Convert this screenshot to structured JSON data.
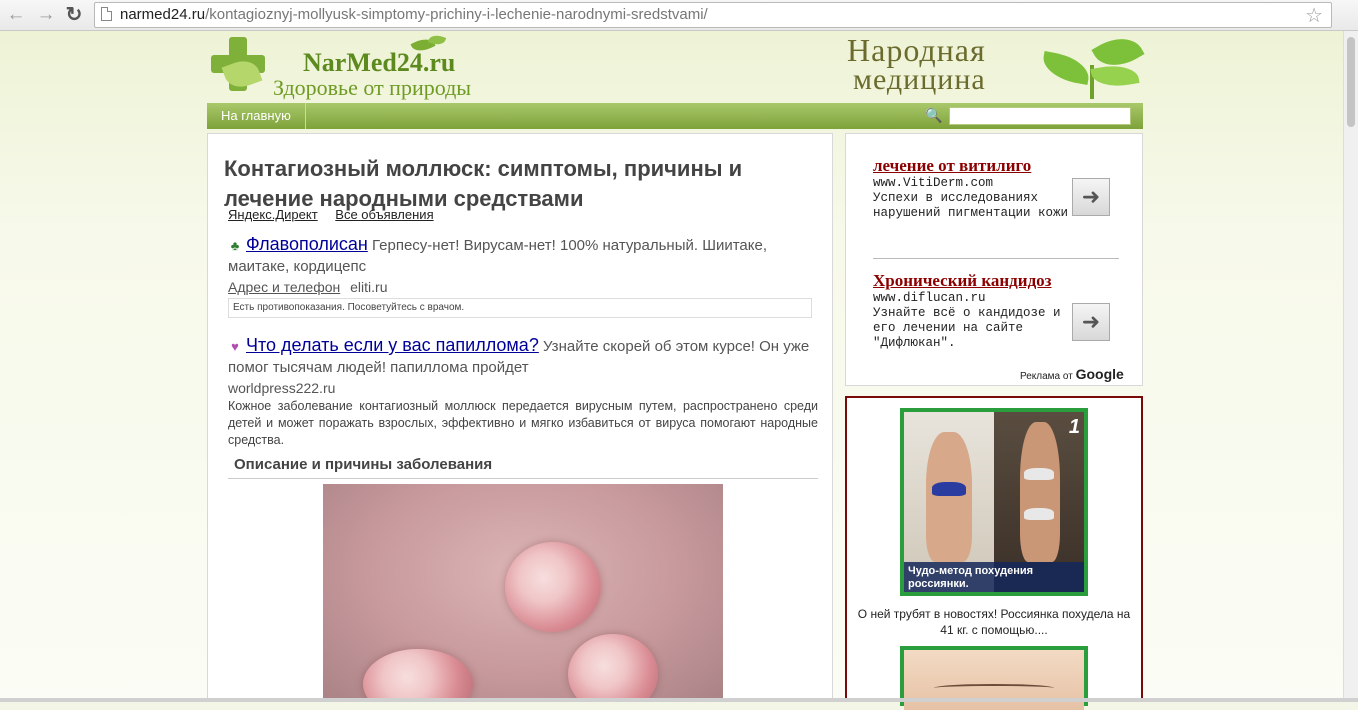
{
  "browser": {
    "url_domain": "narmed24.ru",
    "url_path": "/kontagioznyj-mollyusk-simptomy-prichiny-i-lechenie-narodnymi-sredstvami/"
  },
  "header": {
    "site_name": "NarMed24.ru",
    "tagline": "Здоровье от природы",
    "brand_line1": "Народная",
    "brand_line2": "медицина"
  },
  "nav": {
    "home": "На главную"
  },
  "article": {
    "title": "Контагиозный моллюск: симптомы, причины и лечение народными средствами",
    "ad_links": [
      "Яндекс.Директ",
      "Все объявления"
    ],
    "ads": [
      {
        "marker": "♣",
        "marker_color": "#2e7d32",
        "link": "Флавополисан",
        "text": "Герпесу-нет! Вирусам-нет! 100% натуральный. Шиитаке, маитаке, кордицепс",
        "sub_link": "Адрес и телефон",
        "domain": "eliti.ru",
        "disclaimer": "Есть противопоказания. Посоветуйтесь с врачом."
      },
      {
        "marker": "♥",
        "marker_color": "#b04fb0",
        "link": "Что делать если у вас папиллома?",
        "text": "Узнайте скорей об этом курсе! Он уже помог тысячам людей! папиллома пройдет",
        "domain": "worldpress222.ru"
      }
    ],
    "intro": "Кожное заболевание контагиозный моллюск передается вирусным путем, распространено среди детей и может поражать взрослых, эффективно и мягко избавиться от вируса помогают народные средства.",
    "section_title": "Описание и причины заболевания"
  },
  "sidebar": {
    "ads": [
      {
        "title": "лечение от витилиго",
        "url": "www.VitiDerm.com",
        "desc": "Успехи в исследованиях нарушений пигментации кожи"
      },
      {
        "title": "Хронический кандидоз",
        "url": "www.diflucan.ru",
        "desc": "Узнайте всё о кандидозе и его лечении на сайте \"Дифлюкан\"."
      }
    ],
    "google_label": "Реклама от",
    "google_brand": "Google",
    "promo_caption": "Чудо-метод похудения россиянки.",
    "promo_text": "О ней трубят в новостях! Россиянка похудела на 41 кг. с помощью....",
    "promo_channel": "1"
  }
}
